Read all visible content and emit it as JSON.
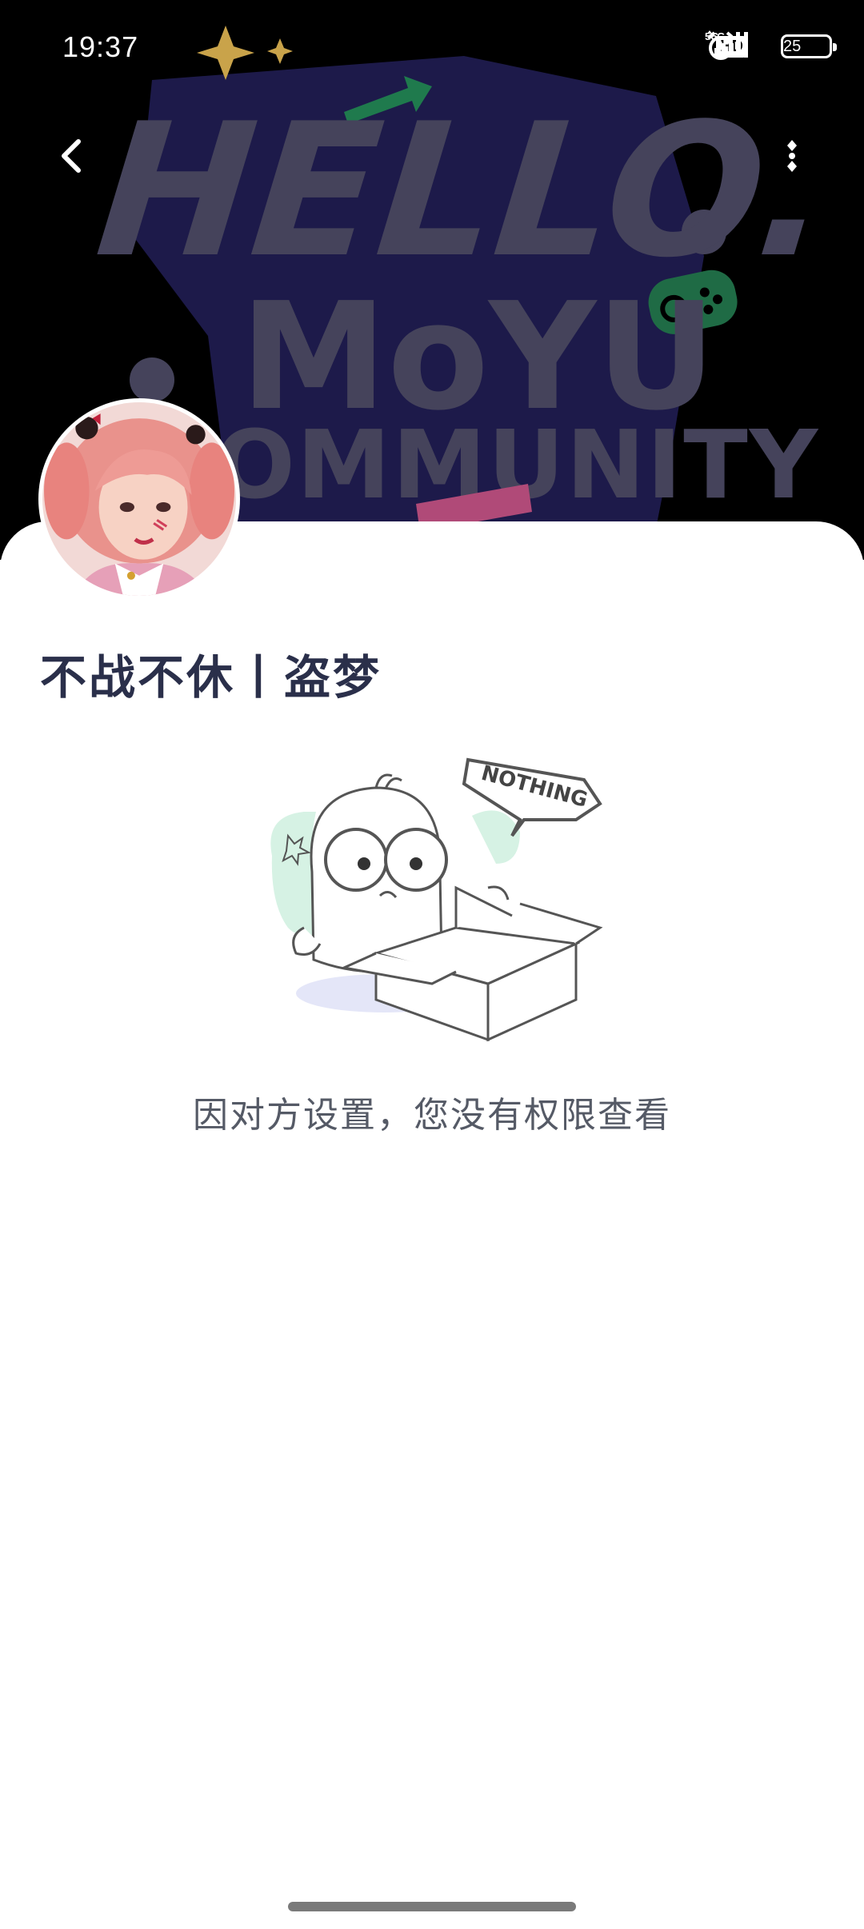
{
  "status_bar": {
    "time": "19:37",
    "hd_label": "HD",
    "network_1": "5G",
    "network_2": "5G",
    "battery_level": "25"
  },
  "banner": {
    "line1": "HELLO.",
    "line2": "MoYU",
    "line3": "COMMUNITY",
    "background_color": "#000000",
    "badge_color": "#1d1a4a",
    "text_color": "#45435b"
  },
  "nav": {
    "back_icon": "chevron-left-icon",
    "more_icon": "vertical-ellipsis-icon"
  },
  "profile": {
    "name": "不战不休丨盗梦",
    "avatar": "avatar-pink-hair-character"
  },
  "empty_state": {
    "sign_text": "NOTHING",
    "message": "因对方设置，您没有权限查看"
  }
}
